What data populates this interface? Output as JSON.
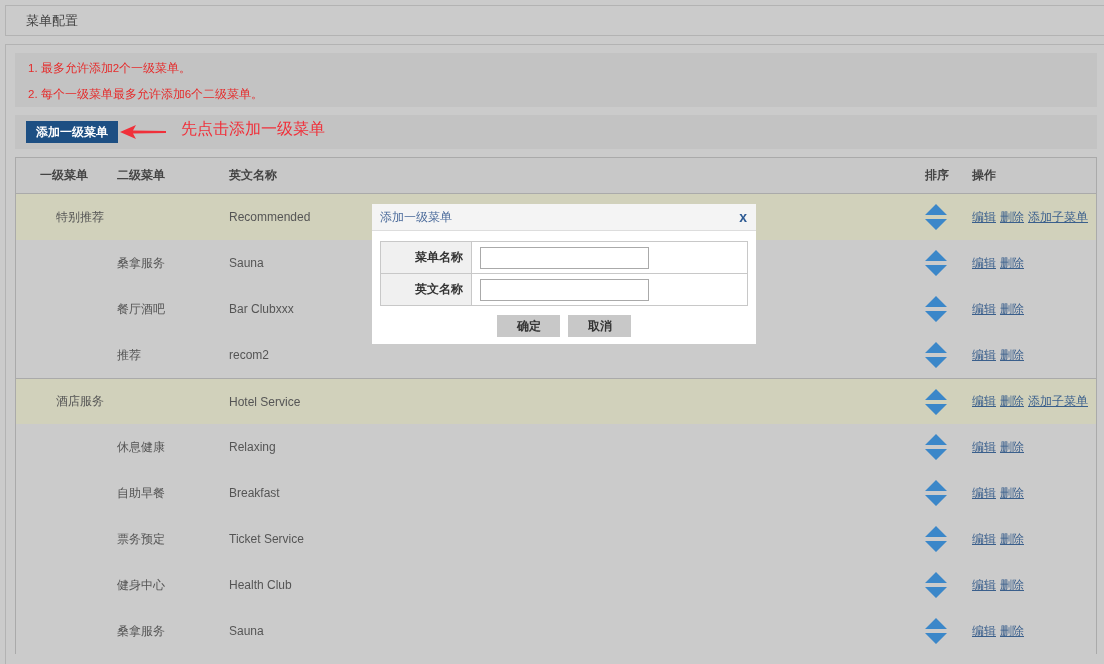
{
  "page_title": "菜单配置",
  "notes": [
    "1. 最多允许添加2个一级菜单。",
    "2. 每个一级菜单最多允许添加6个二级菜单。"
  ],
  "toolbar": {
    "add_button": "添加一级菜单",
    "annotation": "先点击添加一级菜单"
  },
  "table": {
    "columns": [
      "一级菜单",
      "二级菜单",
      "英文名称",
      "排序",
      "操作"
    ],
    "rows": [
      {
        "kind": "primary",
        "level1": "特别推荐",
        "english": "Recommended",
        "actions": [
          "编辑",
          "删除",
          "添加子菜单"
        ]
      },
      {
        "kind": "secondary",
        "level2": "桑拿服务",
        "english": "Sauna",
        "actions": [
          "编辑",
          "删除"
        ]
      },
      {
        "kind": "secondary",
        "level2": "餐厅酒吧",
        "english": "Bar Clubxxx",
        "actions": [
          "编辑",
          "删除"
        ]
      },
      {
        "kind": "secondary",
        "level2": "推荐",
        "english": "recom2",
        "actions": [
          "编辑",
          "删除"
        ]
      },
      {
        "kind": "primary",
        "level1": "酒店服务",
        "english": "Hotel Service",
        "actions": [
          "编辑",
          "删除",
          "添加子菜单"
        ]
      },
      {
        "kind": "secondary",
        "level2": "休息健康",
        "english": "Relaxing",
        "actions": [
          "编辑",
          "删除"
        ]
      },
      {
        "kind": "secondary",
        "level2": "自助早餐",
        "english": "Breakfast",
        "actions": [
          "编辑",
          "删除"
        ]
      },
      {
        "kind": "secondary",
        "level2": "票务预定",
        "english": "Ticket Service",
        "actions": [
          "编辑",
          "删除"
        ]
      },
      {
        "kind": "secondary",
        "level2": "健身中心",
        "english": "Health Club",
        "actions": [
          "编辑",
          "删除"
        ]
      },
      {
        "kind": "secondary",
        "level2": "桑拿服务",
        "english": "Sauna",
        "actions": [
          "编辑",
          "删除"
        ]
      }
    ]
  },
  "dialog": {
    "title": "添加一级菜单",
    "close": "x",
    "fields": [
      {
        "label": "菜单名称"
      },
      {
        "label": "英文名称"
      }
    ],
    "buttons": [
      "确定",
      "取消"
    ]
  }
}
